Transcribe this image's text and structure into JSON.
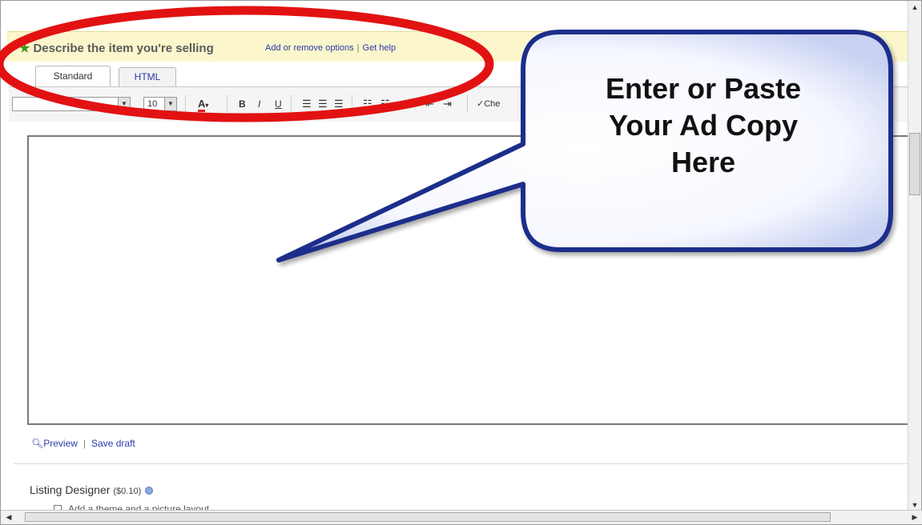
{
  "section": {
    "title": "Describe the item you're selling",
    "links": [
      "Add or remove options",
      "Get help"
    ]
  },
  "tabs": [
    {
      "label": "Standard",
      "selected": true
    },
    {
      "label": "HTML",
      "selected": false
    }
  ],
  "toolbar": {
    "font_size_value": "10",
    "bold_label": "B",
    "italic_label": "I",
    "underline_label": "U",
    "spellcheck_label": "Che"
  },
  "editor_links": {
    "preview_label": "Preview",
    "save_draft_label": "Save draft"
  },
  "listing_designer": {
    "label": "Listing Designer",
    "price": "($0.10)",
    "option_label": "Add a theme and a picture layout"
  },
  "callout": {
    "lines": [
      "Enter or Paste",
      "Your Ad Copy",
      "Here"
    ]
  },
  "colors": {
    "header_bg": "#fbf6cc",
    "link": "#2a39a8",
    "annotation_ring": "#e21212",
    "callout_border": "#1f2f8a"
  }
}
